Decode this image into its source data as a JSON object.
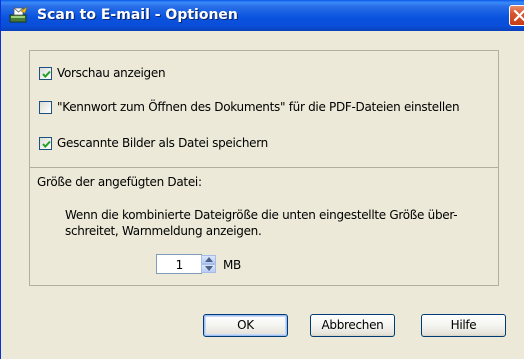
{
  "window": {
    "title": "Scan to E-mail - Optionen",
    "title_icon": "scanner-mail-icon",
    "close_icon": "close-icon"
  },
  "options": {
    "preview": {
      "label": "Vorschau anzeigen",
      "checked": true
    },
    "password": {
      "label": "\"Kennwort zum Öffnen des Dokuments\" für die PDF-Dateien einstellen",
      "checked": false
    },
    "save_images": {
      "label": "Gescannte Bilder als Datei speichern",
      "checked": true
    }
  },
  "attachment": {
    "heading": "Größe der angefügten Datei:",
    "description_line1": "Wenn die kombinierte Dateigröße die unten eingestellte Größe über-",
    "description_line2": "schreitet, Warnmeldung anzeigen.",
    "size_value": "1",
    "size_unit": "MB"
  },
  "buttons": {
    "ok": "OK",
    "cancel": "Abbrechen",
    "help": "Hilfe"
  },
  "colors": {
    "titlebar": "#0a54e0",
    "dialog_bg": "#ece9d8",
    "close_button": "#d8542c",
    "check_mark": "#21a121"
  }
}
